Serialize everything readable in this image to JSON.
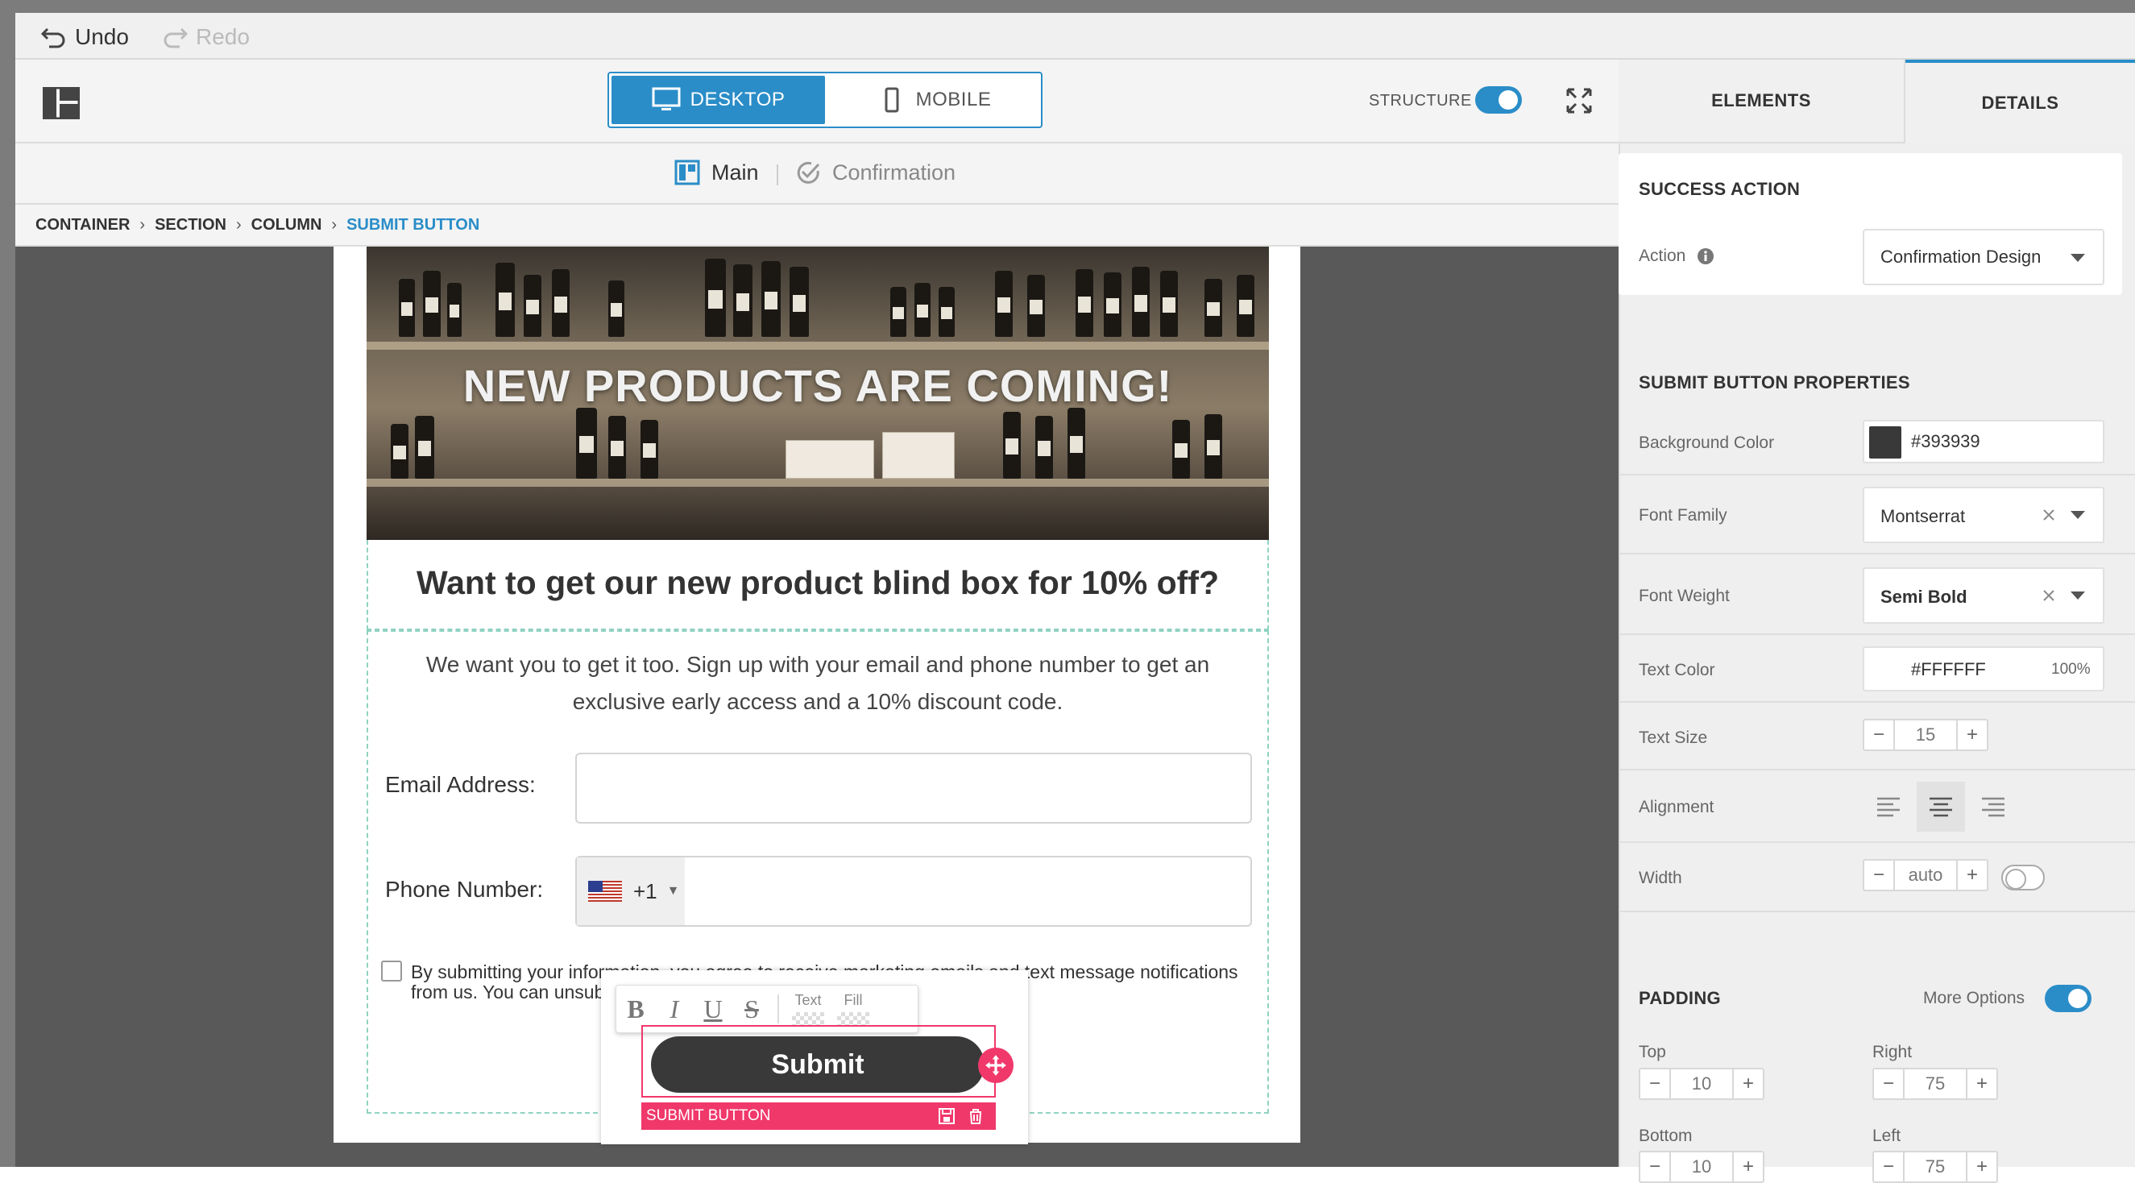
{
  "history": {
    "undo_label": "Undo",
    "redo_label": "Redo"
  },
  "device_toggle": {
    "desktop_label": "DESKTOP",
    "mobile_label": "MOBILE"
  },
  "structure": {
    "label": "STRUCTURE",
    "enabled": true
  },
  "page_tabs": [
    {
      "label": "Main",
      "active": true
    },
    {
      "label": "Confirmation",
      "active": false
    }
  ],
  "breadcrumb": [
    "CONTAINER",
    "SECTION",
    "COLUMN",
    "SUBMIT BUTTON"
  ],
  "form": {
    "hero_title": "NEW PRODUCTS ARE COMING!",
    "headline": "Want to get our new product blind box for 10% off?",
    "description": "We want you to get it too. Sign up with your email and phone number to get an exclusive early access and a 10% discount code.",
    "email_label": "Email Address:",
    "email_value": "",
    "phone_label": "Phone Number:",
    "phone_country_code": "+1",
    "phone_value": "",
    "consent_text": "By submitting your information, you agree to receive marketing emails and text message notifications from us. You can unsubscribe at any time. Msg rates apply.",
    "submit_label": "Submit"
  },
  "editor": {
    "format_buttons": [
      "B",
      "I",
      "U",
      "S"
    ],
    "text_swatch_label": "Text",
    "fill_swatch_label": "Fill",
    "selection_label": "SUBMIT BUTTON"
  },
  "panel": {
    "tabs": [
      {
        "label": "ELEMENTS",
        "active": false
      },
      {
        "label": "DETAILS",
        "active": true
      }
    ],
    "success_action": {
      "title": "SUCCESS ACTION",
      "action_label": "Action",
      "action_value": "Confirmation Design"
    },
    "submit_props": {
      "title": "SUBMIT BUTTON PROPERTIES",
      "background_color_label": "Background Color",
      "background_color": "#393939",
      "font_family_label": "Font Family",
      "font_family": "Montserrat",
      "font_weight_label": "Font Weight",
      "font_weight": "Semi Bold",
      "text_color_label": "Text Color",
      "text_color": "#FFFFFF",
      "text_opacity": "100%",
      "text_size_label": "Text Size",
      "text_size": "15",
      "alignment_label": "Alignment",
      "alignment": "center",
      "width_label": "Width",
      "width": "auto"
    },
    "padding": {
      "title": "PADDING",
      "more_options_label": "More Options",
      "more_options_enabled": true,
      "top_label": "Top",
      "top": "10",
      "right_label": "Right",
      "right": "75",
      "bottom_label": "Bottom",
      "bottom": "10",
      "left_label": "Left",
      "left": "75"
    }
  },
  "colors": {
    "accent": "#2a8dc8",
    "selection": "#f0386b",
    "button": "#393939"
  }
}
